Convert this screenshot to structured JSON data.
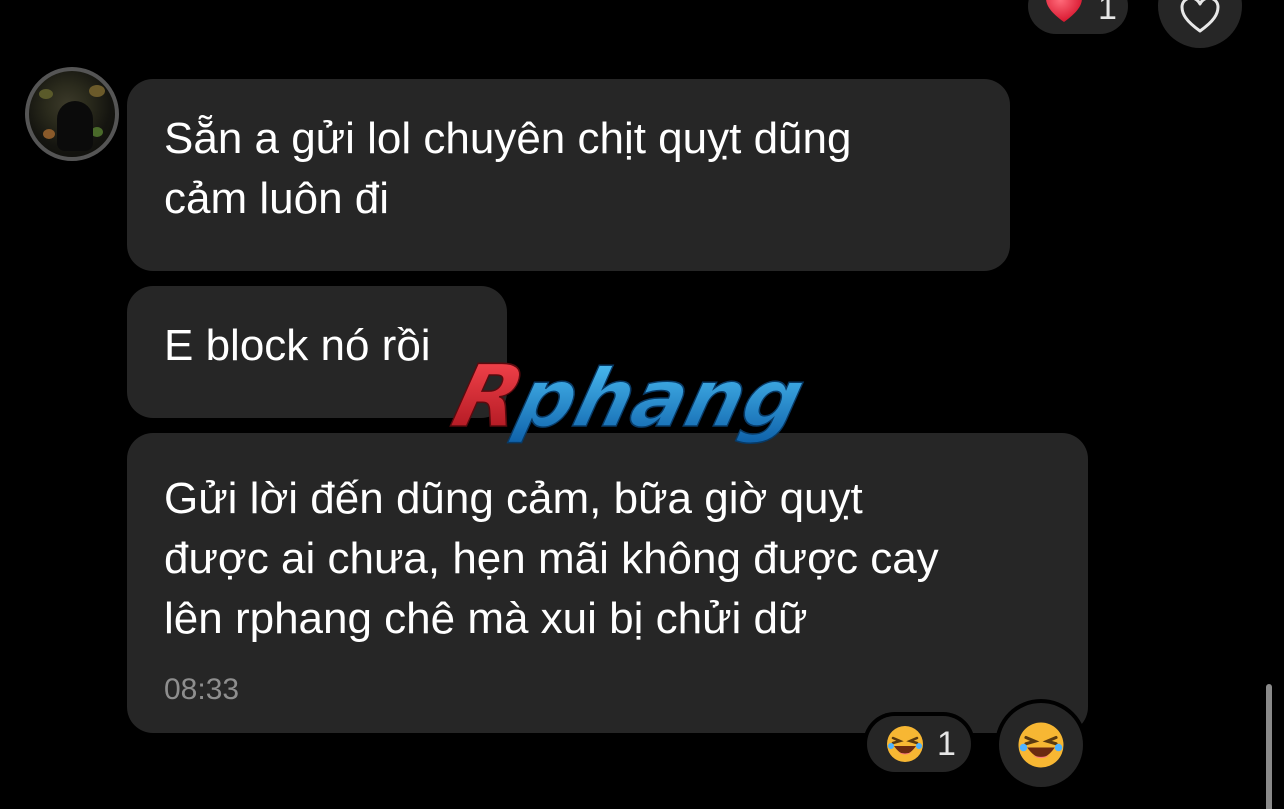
{
  "top_reaction": {
    "emoji": "red-heart-icon",
    "count": "1"
  },
  "like_button": {
    "icon": "heart-outline-icon"
  },
  "messages": [
    {
      "text": "Sẵn a gửi lol chuyên chịt quỵt dũng\ncảm luôn đi"
    },
    {
      "text": "E block nó rồi"
    },
    {
      "text": "Gửi lời đến dũng cảm, bữa giờ quỵt\nđược ai chưa, hẹn mãi không được cay\nlên rphang chê mà xui bị chửi dữ",
      "time": "08:33"
    }
  ],
  "watermark": {
    "text": "Rphang",
    "colors": {
      "r": "#d7262e",
      "rest": "#1e8fd0"
    }
  },
  "bottom_reaction": {
    "emoji": "laughing-emoji-icon",
    "count": "1"
  },
  "colors": {
    "background": "#000000",
    "bubble": "#262626",
    "text": "#ffffff",
    "timestamp": "#8e8e8e"
  }
}
